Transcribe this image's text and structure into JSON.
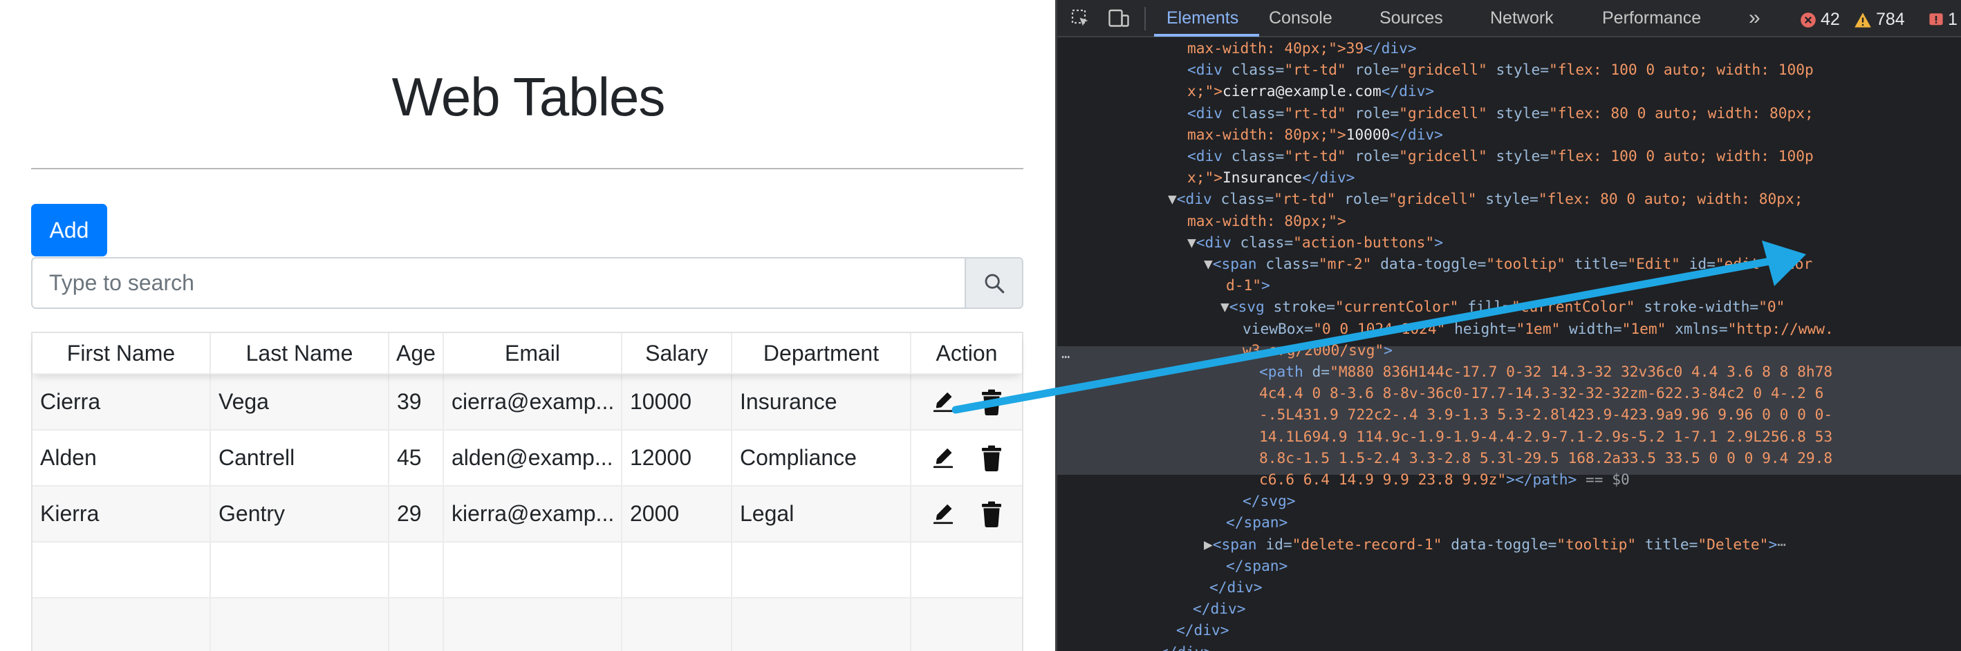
{
  "page": {
    "title": "Web Tables",
    "add_label": "Add",
    "search_placeholder": "Type to search",
    "columns": [
      "First Name",
      "Last Name",
      "Age",
      "Email",
      "Salary",
      "Department",
      "Action"
    ],
    "rows": [
      [
        "Cierra",
        "Vega",
        "39",
        "cierra@examp...",
        "10000",
        "Insurance"
      ],
      [
        "Alden",
        "Cantrell",
        "45",
        "alden@examp...",
        "12000",
        "Compliance"
      ],
      [
        "Kierra",
        "Gentry",
        "29",
        "kierra@examp...",
        "2000",
        "Legal"
      ]
    ]
  },
  "devtools": {
    "tabs": [
      "Elements",
      "Console",
      "Sources",
      "Network",
      "Performance"
    ],
    "active_tab": "Elements",
    "error_count": "42",
    "warning_count": "784",
    "issue_count": "1",
    "code_lines": [
      {
        "i": 188,
        "segs": [
          [
            "val",
            "max-width: 40px;\">39"
          ],
          [
            "tag",
            "</div>"
          ]
        ]
      },
      {
        "i": 188,
        "segs": [
          [
            "tag",
            "<div "
          ],
          [
            "att",
            "class="
          ],
          [
            "val",
            "\"rt-td\" "
          ],
          [
            "att",
            "role="
          ],
          [
            "val",
            "\"gridcell\" "
          ],
          [
            "att",
            "style="
          ],
          [
            "val",
            "\"flex: 100 0 auto; width: 100p"
          ]
        ]
      },
      {
        "i": 188,
        "segs": [
          [
            "val",
            "x;\">"
          ],
          [
            "txt",
            "cierra@example.com"
          ],
          [
            "tag",
            "</div>"
          ]
        ]
      },
      {
        "i": 188,
        "segs": [
          [
            "tag",
            "<div "
          ],
          [
            "att",
            "class="
          ],
          [
            "val",
            "\"rt-td\" "
          ],
          [
            "att",
            "role="
          ],
          [
            "val",
            "\"gridcell\" "
          ],
          [
            "att",
            "style="
          ],
          [
            "val",
            "\"flex: 80 0 auto; width: 80px;"
          ]
        ]
      },
      {
        "i": 188,
        "segs": [
          [
            "val",
            "max-width: 80px;\">"
          ],
          [
            "txt",
            "10000"
          ],
          [
            "tag",
            "</div>"
          ]
        ]
      },
      {
        "i": 188,
        "segs": [
          [
            "tag",
            "<div "
          ],
          [
            "att",
            "class="
          ],
          [
            "val",
            "\"rt-td\" "
          ],
          [
            "att",
            "role="
          ],
          [
            "val",
            "\"gridcell\" "
          ],
          [
            "att",
            "style="
          ],
          [
            "val",
            "\"flex: 100 0 auto; width: 100p"
          ]
        ]
      },
      {
        "i": 188,
        "segs": [
          [
            "val",
            "x;\">"
          ],
          [
            "txt",
            "Insurance"
          ],
          [
            "tag",
            "</div>"
          ]
        ]
      },
      {
        "i": 160,
        "segs": [
          [
            "tri",
            "▼"
          ],
          [
            "tag",
            "<div "
          ],
          [
            "att",
            "class="
          ],
          [
            "val",
            "\"rt-td\" "
          ],
          [
            "att",
            "role="
          ],
          [
            "val",
            "\"gridcell\" "
          ],
          [
            "att",
            "style="
          ],
          [
            "val",
            "\"flex: 80 0 auto; width: 80px;"
          ]
        ]
      },
      {
        "i": 188,
        "segs": [
          [
            "val",
            "max-width: 80px;\">"
          ]
        ]
      },
      {
        "i": 188,
        "segs": [
          [
            "tri",
            "▼"
          ],
          [
            "tag",
            "<div "
          ],
          [
            "att",
            "class="
          ],
          [
            "val",
            "\"action-buttons\""
          ],
          [
            "tag",
            ">"
          ]
        ]
      },
      {
        "i": 212,
        "segs": [
          [
            "tri",
            "▼"
          ],
          [
            "tag",
            "<span "
          ],
          [
            "att",
            "class="
          ],
          [
            "val",
            "\"mr-2\" "
          ],
          [
            "att",
            "data-toggle="
          ],
          [
            "val",
            "\"tooltip\" "
          ],
          [
            "att",
            "title="
          ],
          [
            "val",
            "\"Edit\" "
          ],
          [
            "att",
            "id="
          ],
          [
            "val",
            "\"edit-recor"
          ]
        ]
      },
      {
        "i": 244,
        "segs": [
          [
            "val",
            "d-1\""
          ],
          [
            "tag",
            ">"
          ]
        ]
      },
      {
        "i": 236,
        "segs": [
          [
            "tri",
            "▼"
          ],
          [
            "tag",
            "<svg "
          ],
          [
            "att",
            "stroke="
          ],
          [
            "val",
            "\"currentColor\" "
          ],
          [
            "att",
            "fill="
          ],
          [
            "val",
            "\"currentColor\" "
          ],
          [
            "att",
            "stroke-width="
          ],
          [
            "val",
            "\"0\""
          ]
        ]
      },
      {
        "i": 268,
        "segs": [
          [
            "att",
            "viewBox="
          ],
          [
            "val",
            "\"0 0 1024 1024\" "
          ],
          [
            "att",
            "height="
          ],
          [
            "val",
            "\"1em\" "
          ],
          [
            "att",
            "width="
          ],
          [
            "val",
            "\"1em\" "
          ],
          [
            "att",
            "xmlns="
          ],
          [
            "val",
            "\"http://www."
          ]
        ]
      },
      {
        "i": 268,
        "segs": [
          [
            "val",
            "w3.org/2000/svg\""
          ],
          [
            "tag",
            ">"
          ]
        ]
      },
      {
        "i": 292,
        "segs": [
          [
            "tag",
            "<path "
          ],
          [
            "att",
            "d="
          ],
          [
            "val",
            "\"M880 836H144c-17.7 0-32 14.3-32 32v36c0 4.4 3.6 8 8 8h78"
          ]
        ]
      },
      {
        "i": 292,
        "segs": [
          [
            "val",
            "4c4.4 0 8-3.6 8-8v-36c0-17.7-14.3-32-32-32zm-622.3-84c2 0 4-.2 6"
          ]
        ]
      },
      {
        "i": 292,
        "segs": [
          [
            "val",
            "-.5L431.9 722c2-.4 3.9-1.3 5.3-2.8l423.9-423.9a9.96 9.96 0 0 0 0-"
          ]
        ]
      },
      {
        "i": 292,
        "segs": [
          [
            "val",
            "14.1L694.9 114.9c-1.9-1.9-4.4-2.9-7.1-2.9s-5.2 1-7.1 2.9L256.8 53"
          ]
        ]
      },
      {
        "i": 292,
        "segs": [
          [
            "val",
            "8.8c-1.5 1.5-2.4 3.3-2.8 5.3l-29.5 168.2a33.5 33.5 0 0 0 9.4 29.8"
          ]
        ]
      },
      {
        "i": 292,
        "segs": [
          [
            "val",
            "c6.6 6.4 14.9 9.9 23.8 9.9z\""
          ],
          [
            "tag",
            "></path>"
          ],
          [
            "cmt",
            " == $0"
          ]
        ]
      },
      {
        "i": 268,
        "segs": [
          [
            "tag",
            "</svg>"
          ]
        ]
      },
      {
        "i": 244,
        "segs": [
          [
            "tag",
            "</span>"
          ]
        ]
      },
      {
        "i": 212,
        "segs": [
          [
            "tri",
            "▶"
          ],
          [
            "tag",
            "<span "
          ],
          [
            "att",
            "id="
          ],
          [
            "val",
            "\"delete-record-1\" "
          ],
          [
            "att",
            "data-toggle="
          ],
          [
            "val",
            "\"tooltip\" "
          ],
          [
            "att",
            "title="
          ],
          [
            "val",
            "\"Delete\""
          ],
          [
            "tag",
            ">"
          ],
          [
            "cmt",
            "⋯"
          ]
        ]
      },
      {
        "i": 244,
        "segs": [
          [
            "tag",
            "</span>"
          ]
        ]
      },
      {
        "i": 220,
        "segs": [
          [
            "tag",
            "</div>"
          ]
        ]
      },
      {
        "i": 196,
        "segs": [
          [
            "tag",
            "</div>"
          ]
        ]
      },
      {
        "i": 172,
        "segs": [
          [
            "tag",
            "</div>"
          ]
        ]
      },
      {
        "i": 148,
        "segs": [
          [
            "tag",
            "</div>"
          ]
        ]
      }
    ]
  },
  "colors": {
    "add_button": "#007bff",
    "devtools_bg": "#202124",
    "arrow": "#1ea7e4"
  }
}
